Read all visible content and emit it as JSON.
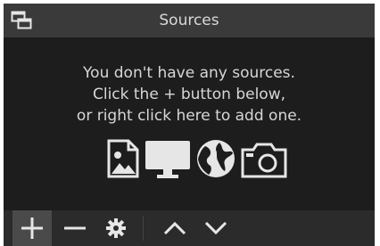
{
  "panel": {
    "title": "Sources",
    "colors": {
      "background": "#1d1d1d",
      "titlebar": "#3a3a3a",
      "text": "#d7d7d7",
      "icon": "#e6e6e6"
    }
  },
  "empty_state": {
    "line1": "You don't have any sources.",
    "line2": "Click the + button below,",
    "line3": "or right click here to add one.",
    "icons": [
      "image-icon",
      "display-icon",
      "globe-icon",
      "camera-icon"
    ]
  },
  "toolbar": {
    "buttons": [
      "add-icon",
      "remove-icon",
      "gear-icon",
      "move-up-icon",
      "move-down-icon"
    ]
  }
}
